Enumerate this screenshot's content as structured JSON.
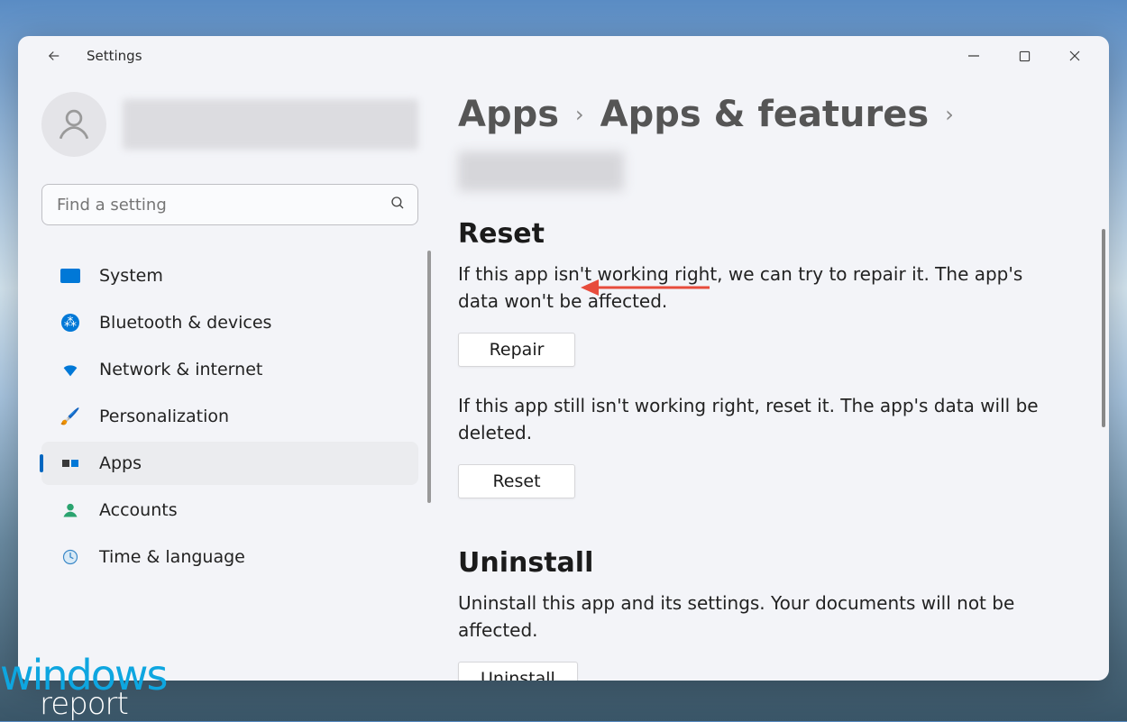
{
  "window": {
    "title": "Settings"
  },
  "search": {
    "placeholder": "Find a setting"
  },
  "sidebar": {
    "items": [
      {
        "label": "System"
      },
      {
        "label": "Bluetooth & devices"
      },
      {
        "label": "Network & internet"
      },
      {
        "label": "Personalization"
      },
      {
        "label": "Apps"
      },
      {
        "label": "Accounts"
      },
      {
        "label": "Time & language"
      }
    ],
    "active_index": 4
  },
  "breadcrumb": {
    "level1": "Apps",
    "level2": "Apps & features",
    "level3": "[redacted]"
  },
  "main": {
    "reset": {
      "heading": "Reset",
      "repair_desc": "If this app isn't working right, we can try to repair it. The app's data won't be affected.",
      "repair_button": "Repair",
      "reset_desc": "If this app still isn't working right, reset it. The app's data will be deleted.",
      "reset_button": "Reset"
    },
    "uninstall": {
      "heading": "Uninstall",
      "desc": "Uninstall this app and its settings. Your documents will not be affected.",
      "button": "Uninstall"
    }
  },
  "watermark": {
    "line1": "windows",
    "line2": "report"
  }
}
